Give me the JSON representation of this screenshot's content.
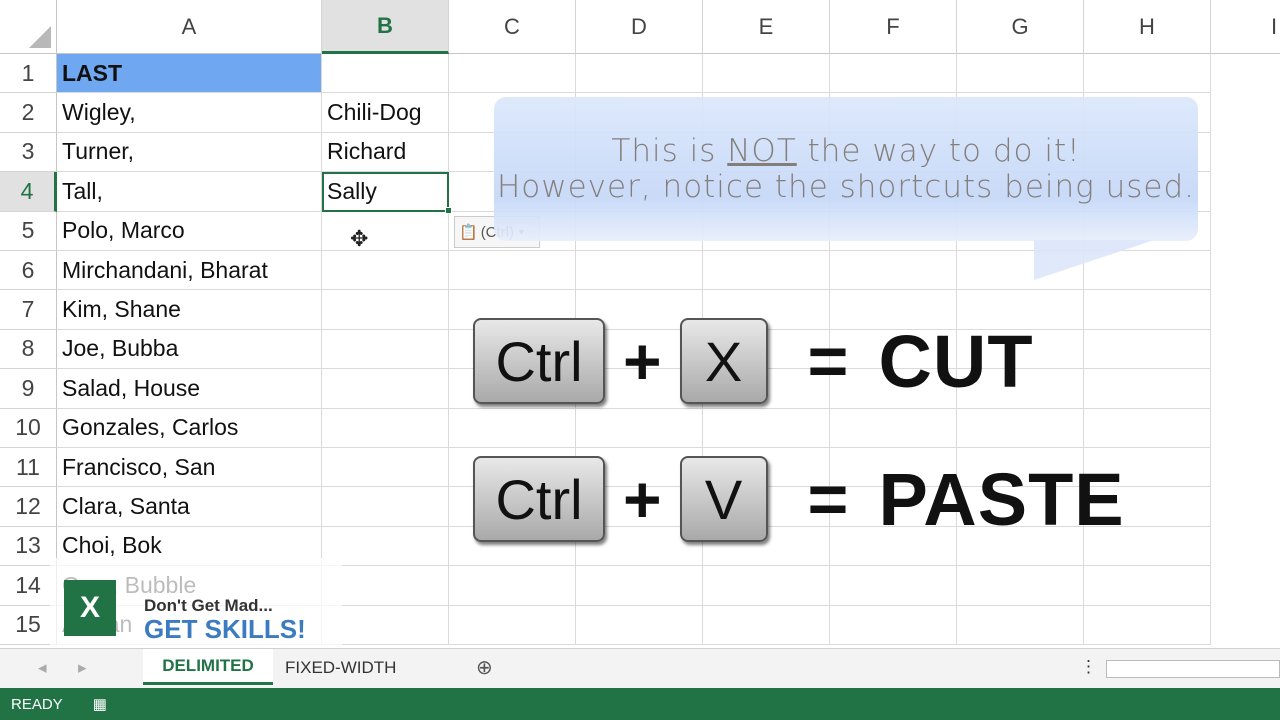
{
  "columns": [
    "A",
    "B",
    "C",
    "D",
    "E",
    "F",
    "G",
    "H",
    "I"
  ],
  "rows": [
    "1",
    "2",
    "3",
    "4",
    "5",
    "6",
    "7",
    "8",
    "9",
    "10",
    "11",
    "12",
    "13",
    "14",
    "15"
  ],
  "colA": [
    "LAST",
    "Wigley,",
    "Turner,",
    "Tall,",
    "Polo, Marco",
    "Mirchandani, Bharat",
    "Kim, Shane",
    "Joe, Bubba",
    "Salad, House",
    "Gonzales, Carlos",
    "Francisco, San",
    "Clara, Santa",
    "Choi, Bok",
    "Gum, Bubble",
    "Alexan"
  ],
  "colB": [
    "",
    "Chili-Dog",
    "Richard",
    "Sally",
    "",
    "",
    "",
    "",
    "",
    "",
    "",
    "",
    "",
    "",
    ""
  ],
  "paste_options": "(Ctrl)",
  "callout": {
    "line1_pre": "This is ",
    "line1_emph": "NOT",
    "line1_post": " the way to do it!",
    "line2": "However, notice the shortcuts being used."
  },
  "shortcuts": [
    {
      "mod": "Ctrl",
      "key": "X",
      "action": "CUT"
    },
    {
      "mod": "Ctrl",
      "key": "V",
      "action": "PASTE"
    }
  ],
  "sheet_tabs": [
    "DELIMITED",
    "FIXED-WIDTH"
  ],
  "status": "READY",
  "logo": {
    "line1": "Don't Get Mad...",
    "line2": "GET SKILLS!"
  }
}
